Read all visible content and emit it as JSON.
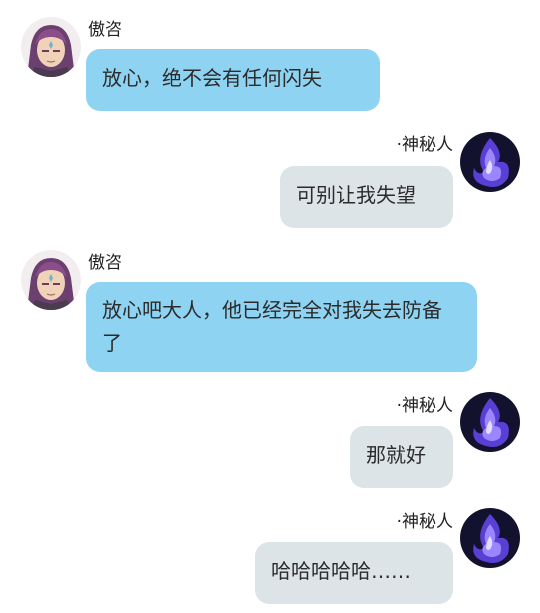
{
  "messages": [
    {
      "side": "left",
      "sender": "傲咨",
      "avatar_icon": "purple-hair-character-avatar",
      "text": "放心，绝不会有任何闪失"
    },
    {
      "side": "right",
      "sender": "·神秘人",
      "avatar_icon": "mystic-purple-flame-avatar",
      "text": "可别让我失望"
    },
    {
      "side": "left",
      "sender": "傲咨",
      "avatar_icon": "purple-hair-character-avatar",
      "text": "放心吧大人，他已经完全对我失去防备了"
    },
    {
      "side": "right",
      "sender": "·神秘人",
      "avatar_icon": "mystic-purple-flame-avatar",
      "text": "那就好"
    },
    {
      "side": "right",
      "sender": "·神秘人",
      "avatar_icon": "mystic-purple-flame-avatar",
      "text": "哈哈哈哈哈……"
    }
  ],
  "colors": {
    "left_bubble": "#8fd3f2",
    "right_bubble": "#dde4e8",
    "background": "#ffffff"
  }
}
